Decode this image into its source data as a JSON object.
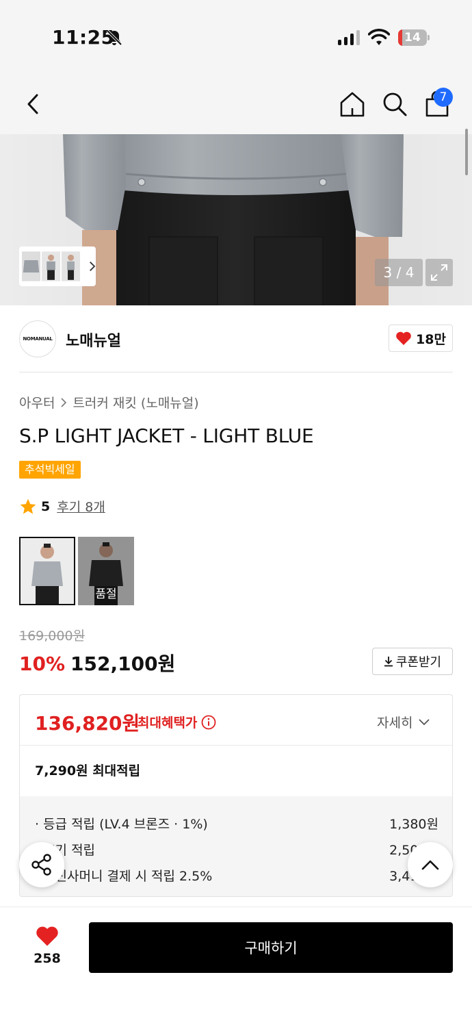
{
  "status_bar": {
    "time": "11:25",
    "battery": "14",
    "battery_level": 0.14
  },
  "nav": {
    "cart_count": "7"
  },
  "gallery": {
    "pager": "3 / 4"
  },
  "brand": {
    "logo_text": "NOMANUAL",
    "name": "노매뉴얼",
    "likes": "18만"
  },
  "product": {
    "breadcrumb": [
      "아우터",
      "트러커 재킷 (노매뉴얼)"
    ],
    "title": "S.P LIGHT JACKET - LIGHT BLUE",
    "sale_badge": "추석빅세일",
    "rating": "5",
    "reviews": "후기 8개",
    "variants": [
      {
        "label": "",
        "selected": true
      },
      {
        "label": "품절",
        "selected": false
      }
    ],
    "original_price": "169,000원",
    "discount": "10%",
    "price": "152,100원",
    "coupon_label": "쿠폰받기"
  },
  "benefit": {
    "max_price": "136,820원",
    "max_label": "최대혜택가",
    "detail_label": "자세히",
    "points_title": "7,290원 최대적립",
    "points": [
      {
        "label": "· 등급 적립 (LV.4 브론즈 · 1%)",
        "value": "1,380원"
      },
      {
        "label": "· 후기 적립",
        "value": "2,500원"
      },
      {
        "label": "· 무신사머니 결제 시 적립 2.5%",
        "value": "3,410원"
      }
    ]
  },
  "bottom": {
    "wish_count": "258",
    "buy_label": "구매하기"
  },
  "colors": {
    "accent_red": "#e02020",
    "badge_orange": "#ffa400",
    "cart_badge_blue": "#1f6bff"
  }
}
